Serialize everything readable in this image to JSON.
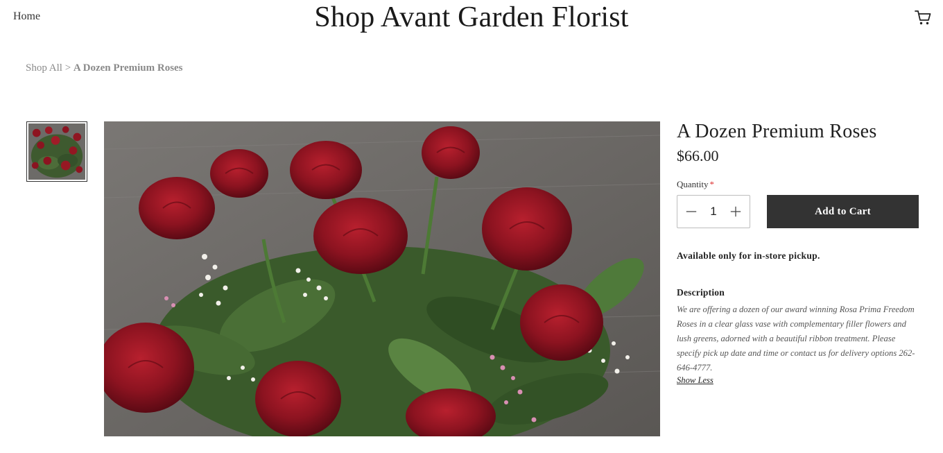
{
  "header": {
    "nav_home": "Home",
    "site_title": "Shop Avant Garden Florist",
    "cart_icon": "cart-icon"
  },
  "breadcrumb": {
    "parent": "Shop All",
    "separator": " > ",
    "current": "A Dozen Premium Roses"
  },
  "gallery": {
    "thumbnail_icon": "product-thumbnail",
    "main_image": "product-photo-roses"
  },
  "product": {
    "title": "A Dozen Premium Roses",
    "price": "$66.00",
    "quantity_label": "Quantity",
    "required_mark": "*",
    "quantity_value": "1",
    "add_to_cart_label": "Add to Cart",
    "pickup_note": "Available only for in-store pickup.",
    "description_heading": "Description",
    "description_text": "We are offering a dozen of our award winning Rosa Prima Freedom Roses in a clear glass vase with complementary filler flowers and lush greens, adorned with a beautiful ribbon treatment. Please specify pick up date and time or contact us for delivery options 262-646-4777.",
    "show_less_label": "Show Less"
  },
  "colors": {
    "button_bg": "#333333",
    "required": "#dd3333",
    "rose": "#8e1420",
    "leaf": "#3d5a2e"
  }
}
